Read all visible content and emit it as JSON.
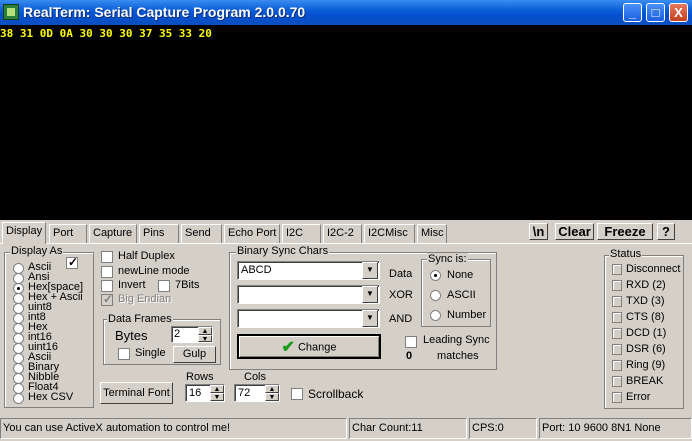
{
  "window": {
    "title": "RealTerm: Serial Capture Program 2.0.0.70",
    "min_glyph": "_",
    "max_glyph": "□",
    "close_glyph": "X"
  },
  "terminal": {
    "line": "38 31 0D 0A 30 30 30 37 35 33 20"
  },
  "tabs": [
    "Display",
    "Port",
    "Capture",
    "Pins",
    "Send",
    "Echo Port",
    "I2C",
    "I2C-2",
    "I2CMisc",
    "Misc"
  ],
  "active_tab": "Display",
  "toolbar": {
    "newline_label": "\\n",
    "clear_label": "Clear",
    "freeze_label": "Freeze",
    "help_label": "?"
  },
  "display_as": {
    "label": "Display As",
    "options": [
      "Ascii",
      "Ansi",
      "Hex[space]",
      "Hex + Ascii",
      "uint8",
      "int8",
      "Hex",
      "int16",
      "uint16",
      "Ascii",
      "Binary",
      "Nibble",
      "Float4",
      "Hex CSV"
    ],
    "selected": "Hex[space]"
  },
  "options": {
    "half_duplex": "Half Duplex",
    "newline_mode": "newLine mode",
    "invert": "Invert",
    "seven_bits": "7Bits",
    "big_endian": "Big Endian"
  },
  "data_frames": {
    "label": "Data Frames",
    "bytes_label": "Bytes",
    "bytes_value": "2",
    "single_label": "Single",
    "gulp_label": "Gulp"
  },
  "terminal_font_label": "Terminal Font",
  "rows": {
    "label": "Rows",
    "value": "16"
  },
  "cols": {
    "label": "Cols",
    "value": "72"
  },
  "scrollback_label": "Scrollback",
  "binary_sync": {
    "label": "Binary Sync Chars",
    "data_value": "ABCD",
    "data_label": "Data",
    "xor_label": "XOR",
    "and_label": "AND",
    "change_label": "Change",
    "leading_sync_label": "Leading Sync",
    "matches_count": "0",
    "matches_label": "matches",
    "sync_is_label": "Sync is:",
    "sync_options": [
      "None",
      "ASCII",
      "Number"
    ],
    "sync_selected": "None"
  },
  "status": {
    "label": "Status",
    "items": [
      "Disconnect",
      "RXD (2)",
      "TXD (3)",
      "CTS (8)",
      "DCD (1)",
      "DSR (6)",
      "Ring (9)",
      "BREAK",
      "Error"
    ]
  },
  "statusbar": {
    "message": "You can use ActiveX automation to control me!",
    "char_count": "Char Count:11",
    "cps": "CPS:0",
    "port": "Port: 10 9600 8N1 None"
  }
}
